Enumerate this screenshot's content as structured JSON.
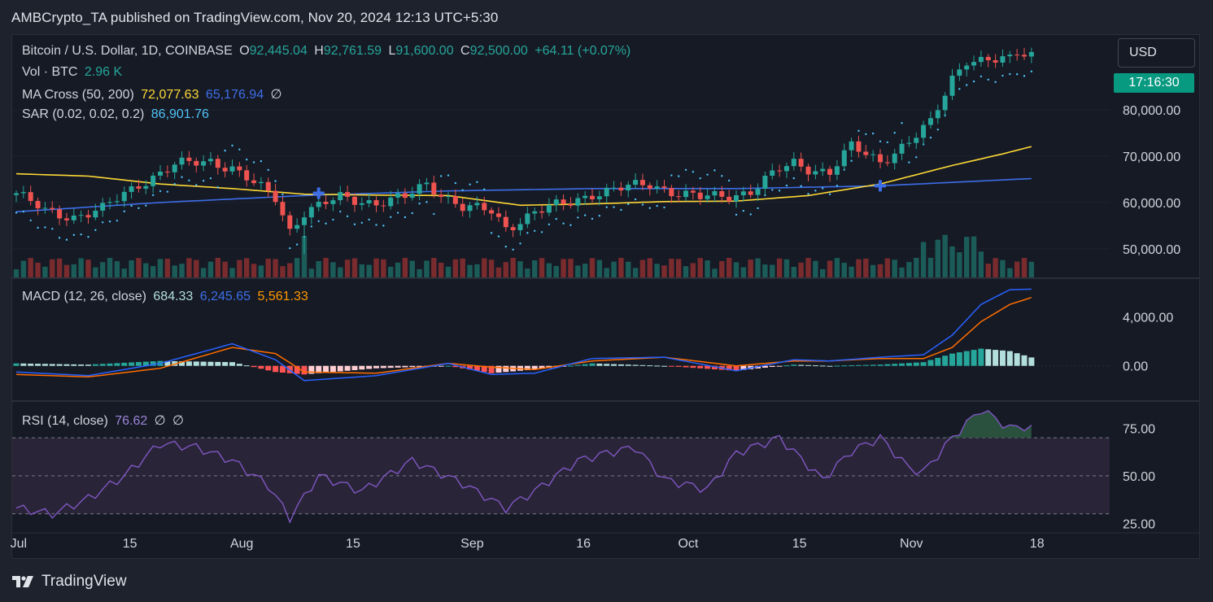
{
  "header": {
    "publisher_line": "AMBCrypto_TA published on TradingView.com, Nov 20, 2024 12:13 UTC+5:30"
  },
  "legend": {
    "symbol": "Bitcoin / U.S. Dollar, 1D, COINBASE",
    "o_label": "O",
    "o_value": "92,445.04",
    "h_label": "H",
    "h_value": "92,761.59",
    "l_label": "L",
    "l_value": "91,600.00",
    "c_label": "C",
    "c_value": "92,500.00",
    "change": "+64.11 (+0.07%)",
    "vol_label": "Vol · BTC",
    "vol_value": "2.96 K",
    "ma_label": "MA Cross (50, 200)",
    "ma50": "72,077.63",
    "ma200": "65,176.94",
    "ma_extra": "∅",
    "sar_label": "SAR (0.02, 0.02, 0.2)",
    "sar_value": "86,901.76",
    "macd_label": "MACD (12, 26, close)",
    "macd_hist": "684.33",
    "macd_line": "6,245.65",
    "macd_signal": "5,561.33",
    "rsi_label": "RSI (14, close)",
    "rsi_value": "76.62",
    "rsi_extra1": "∅",
    "rsi_extra2": "∅"
  },
  "controls": {
    "currency_button": "USD",
    "countdown": "17:16:30"
  },
  "footer": {
    "brand": "TradingView"
  },
  "colors": {
    "up": "#26a69a",
    "down": "#ef5350",
    "ma50": "#fdd835",
    "ma200": "#3d6ee8",
    "sar": "#4fc3f7",
    "macd_line": "#2962ff",
    "macd_signal": "#ff6d00",
    "rsi": "#7e57c2"
  },
  "chart_data": {
    "type": "line",
    "subtype": "candlestick with volume, MA cross, SAR, MACD and RSI panes",
    "x_ticks": [
      "Jul",
      "15",
      "Aug",
      "15",
      "Sep",
      "16",
      "Oct",
      "15",
      "Nov",
      "18"
    ],
    "price_axis": {
      "ticks": [
        "80,000.00",
        "70,000.00",
        "60,000.00",
        "50,000.00"
      ],
      "ylim": [
        44000,
        96000
      ]
    },
    "macd_axis": {
      "ticks": [
        "4,000.00",
        "0.00"
      ],
      "ylim": [
        -2800,
        7000
      ]
    },
    "rsi_axis": {
      "ticks": [
        "75.00",
        "50.00",
        "25.00"
      ],
      "ylim": [
        20,
        88
      ],
      "band": [
        30,
        70
      ]
    },
    "anchors": {
      "note": "approximate closing-price path, one point per listed day",
      "days": [
        0,
        4,
        8,
        12,
        17,
        22,
        27,
        30,
        33,
        36,
        38,
        40,
        45,
        50,
        54,
        57,
        62,
        66,
        68,
        72,
        77,
        80,
        84,
        88,
        92,
        95,
        99,
        102,
        106,
        108,
        110,
        113,
        116,
        120,
        124,
        127,
        130,
        132,
        134,
        136,
        138,
        139,
        141
      ],
      "close": [
        62000,
        58000,
        57000,
        58500,
        64000,
        68000,
        69000,
        67500,
        64000,
        61000,
        54000,
        58000,
        61000,
        60000,
        61000,
        64000,
        59000,
        58000,
        54500,
        58000,
        60000,
        62000,
        63000,
        64000,
        62000,
        61000,
        61500,
        62500,
        67000,
        68500,
        67500,
        66500,
        72000,
        69000,
        73000,
        77000,
        87000,
        91000,
        90500,
        90500,
        90800,
        92445,
        92500
      ]
    },
    "ma50_path": {
      "days": [
        0,
        10,
        20,
        30,
        40,
        50,
        60,
        70,
        80,
        90,
        100,
        110,
        120,
        130,
        137,
        141
      ],
      "values": [
        66200,
        65700,
        64000,
        63000,
        61800,
        61600,
        61500,
        59400,
        59700,
        60200,
        60300,
        61500,
        64000,
        68000,
        70500,
        72078
      ]
    },
    "ma200_path": {
      "days": [
        0,
        20,
        40,
        60,
        80,
        100,
        120,
        141
      ],
      "values": [
        58000,
        60000,
        61500,
        62500,
        63000,
        63000,
        63600,
        65177
      ]
    },
    "macd_path": {
      "days": [
        0,
        10,
        20,
        30,
        36,
        40,
        50,
        60,
        66,
        72,
        80,
        90,
        100,
        108,
        113,
        120,
        126,
        130,
        134,
        138,
        141
      ],
      "macd": [
        -500,
        -800,
        200,
        1800,
        500,
        -1200,
        -800,
        200,
        -700,
        -600,
        600,
        700,
        -400,
        500,
        400,
        700,
        900,
        2500,
        5000,
        6200,
        6245
      ],
      "signal": [
        -700,
        -900,
        -200,
        1500,
        1000,
        -500,
        -600,
        200,
        -100,
        -300,
        400,
        700,
        0,
        400,
        400,
        600,
        600,
        1500,
        3600,
        5000,
        5561
      ]
    },
    "rsi_path": {
      "days": [
        0,
        5,
        10,
        15,
        20,
        25,
        30,
        35,
        38,
        42,
        48,
        55,
        62,
        68,
        72,
        78,
        82,
        86,
        90,
        96,
        100,
        106,
        112,
        116,
        120,
        124,
        126,
        130,
        134,
        138,
        141
      ],
      "rsi": [
        33,
        30,
        38,
        50,
        67,
        65,
        58,
        45,
        28,
        50,
        42,
        58,
        46,
        33,
        42,
        58,
        62,
        65,
        48,
        43,
        62,
        70,
        48,
        63,
        70,
        54,
        52,
        70,
        85,
        75,
        76.62
      ]
    },
    "title": "Bitcoin / U.S. Dollar, 1D, COINBASE"
  }
}
